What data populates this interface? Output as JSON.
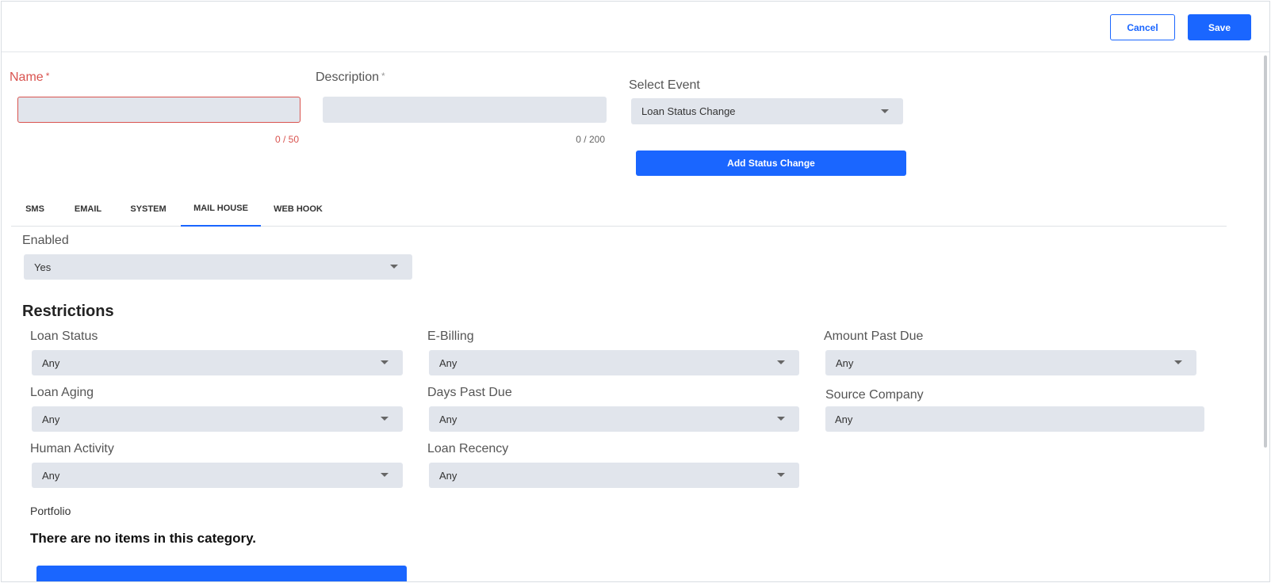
{
  "toolbar": {
    "cancel_label": "Cancel",
    "save_label": "Save"
  },
  "form": {
    "name": {
      "label": "Name",
      "required_mark": "*",
      "value": "",
      "counter": "0 / 50"
    },
    "description": {
      "label": "Description",
      "required_mark": "*",
      "value": "",
      "counter": "0 / 200"
    },
    "event": {
      "label": "Select Event",
      "selected": "Loan Status Change"
    },
    "add_status_change_label": "Add Status Change"
  },
  "tabs": [
    {
      "label": "SMS",
      "active": false
    },
    {
      "label": "EMAIL",
      "active": false
    },
    {
      "label": "SYSTEM",
      "active": false
    },
    {
      "label": "MAIL HOUSE",
      "active": true
    },
    {
      "label": "WEB HOOK",
      "active": false
    }
  ],
  "enabled": {
    "label": "Enabled",
    "selected": "Yes"
  },
  "restrictions": {
    "title": "Restrictions",
    "loan_status": {
      "label": "Loan Status",
      "selected": "Any"
    },
    "e_billing": {
      "label": "E-Billing",
      "selected": "Any"
    },
    "amount_past_due": {
      "label": "Amount Past Due",
      "selected": "Any"
    },
    "loan_aging": {
      "label": "Loan Aging",
      "selected": "Any"
    },
    "days_past_due": {
      "label": "Days Past Due",
      "selected": "Any"
    },
    "source_company": {
      "label": "Source Company",
      "value": "Any"
    },
    "human_activity": {
      "label": "Human Activity",
      "selected": "Any"
    },
    "loan_recency": {
      "label": "Loan Recency",
      "selected": "Any"
    }
  },
  "portfolio": {
    "label": "Portfolio",
    "empty_message": "There are no items in this category."
  },
  "colors": {
    "primary": "#1a66ff",
    "error": "#d9534f",
    "field_bg": "#e1e5ec"
  }
}
